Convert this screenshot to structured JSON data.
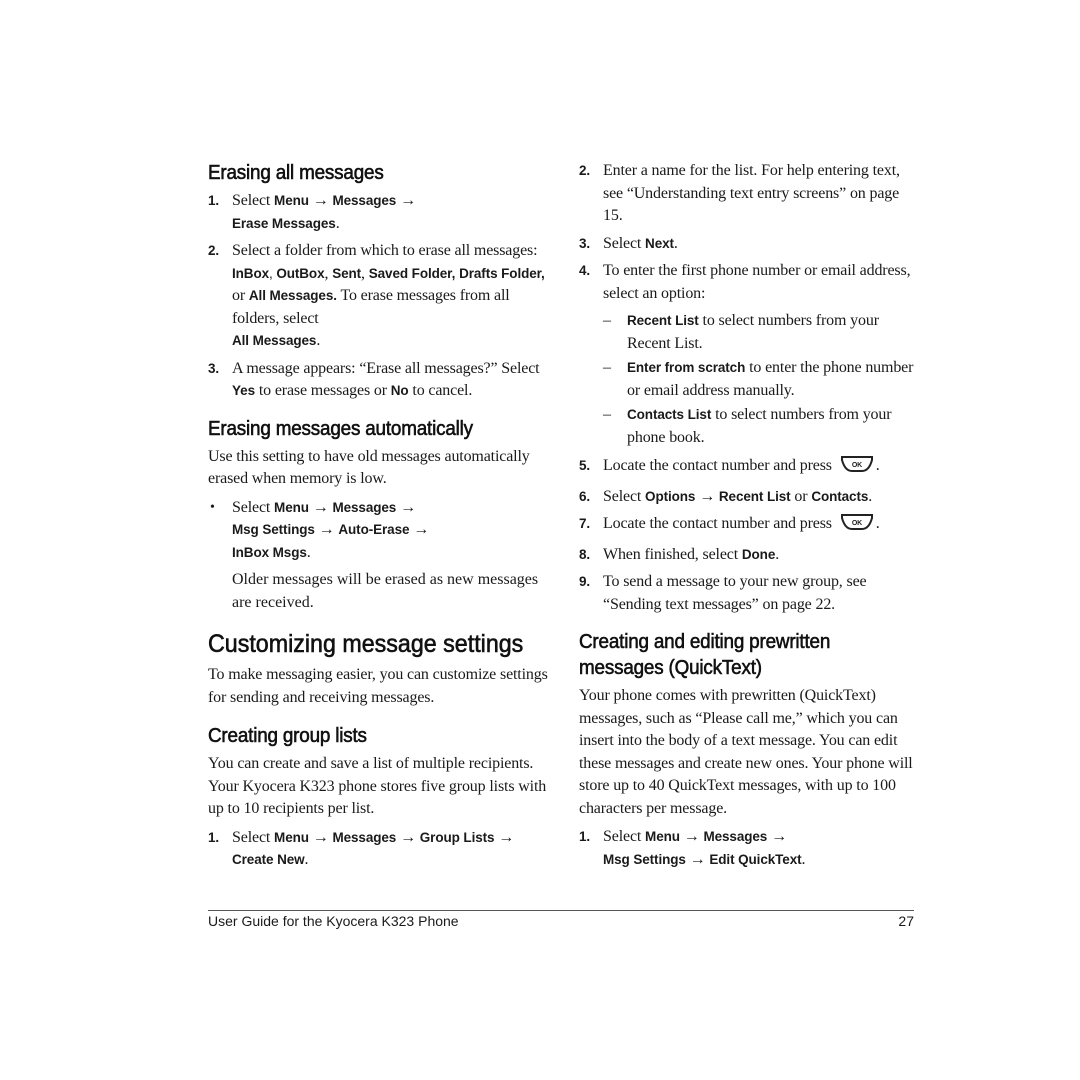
{
  "left": {
    "erasing_all": {
      "heading": "Erasing all messages",
      "step1": {
        "num": "1.",
        "t1": "Select ",
        "b1": "Menu",
        "a1": " → ",
        "b2": "Messages",
        "a2": " →",
        "b3": "Erase Messages",
        "t2": "."
      },
      "step2": {
        "num": "2.",
        "t1": "Select a folder from which to erase all messages: ",
        "b1": "InBox",
        "c1": ", ",
        "b2": "OutBox",
        "c2": ", ",
        "b3": "Sent",
        "c3": ", ",
        "b4": "Saved Folder,",
        "b5": "Drafts Folder,",
        "t2": " or ",
        "b6": "All Messages.",
        "t3": " To erase messages from all folders, select",
        "b7": "All Messages",
        "t4": "."
      },
      "step3": {
        "num": "3.",
        "t1": "A message appears: “Erase all messages?” Select ",
        "b1": "Yes",
        "t2": " to erase messages or ",
        "b2": "No",
        "t3": " to cancel."
      }
    },
    "erasing_auto": {
      "heading": "Erasing messages automatically",
      "intro": "Use this setting to have old messages automatically erased when memory is low.",
      "bullet": {
        "symbol": "•",
        "t1": "Select ",
        "b1": "Menu",
        "a1": " → ",
        "b2": "Messages",
        "a2": " →",
        "b3": "Msg Settings",
        "a3": " → ",
        "b4": "Auto-Erase",
        "a4": " →",
        "b5": "InBox Msgs",
        "t2": "."
      },
      "note": "Older messages will be erased as new messages are received."
    },
    "customizing": {
      "heading": "Customizing message settings",
      "intro": "To make messaging easier, you can customize settings for sending and receiving messages."
    },
    "group_lists": {
      "heading": "Creating group lists",
      "intro": "You can create and save a list of multiple recipients. Your Kyocera K323 phone stores five group lists with up to 10 recipients per list.",
      "step1": {
        "num": "1.",
        "t1": "Select ",
        "b1": "Menu",
        "a1": " → ",
        "b2": "Messages",
        "a2": " → ",
        "b3": "Group Lists",
        "a3": " →",
        "b4": "Create New",
        "t2": "."
      }
    }
  },
  "right": {
    "step2": {
      "num": "2.",
      "text": "Enter a name for the list. For help entering text, see “Understanding text entry screens” on page 15."
    },
    "step3": {
      "num": "3.",
      "t1": "Select ",
      "b1": "Next",
      "t2": "."
    },
    "step4": {
      "num": "4.",
      "text": "To enter the first phone number or email address, select an option:"
    },
    "options": [
      {
        "dash": "–",
        "bold": "Recent List",
        "text": " to select numbers from your Recent List."
      },
      {
        "dash": "–",
        "bold": "Enter from scratch",
        "text": " to enter the phone number or email address manually."
      },
      {
        "dash": "–",
        "bold": "Contacts List",
        "text": " to select numbers from your phone book."
      }
    ],
    "step5": {
      "num": "5.",
      "text": "Locate the contact number and press",
      "key": "OK",
      "end": "."
    },
    "step6": {
      "num": "6.",
      "t1": "Select ",
      "b1": "Options",
      "a1": " → ",
      "b2": "Recent List",
      "t2": " or ",
      "b3": "Contacts",
      "t3": "."
    },
    "step7": {
      "num": "7.",
      "text": "Locate the contact number and press",
      "key": "OK",
      "end": "."
    },
    "step8": {
      "num": "8.",
      "t1": "When finished, select ",
      "b1": "Done",
      "t2": "."
    },
    "step9": {
      "num": "9.",
      "text": "To send a message to your new group, see “Sending text messages” on page 22."
    },
    "quicktext": {
      "heading_line1": "Creating and editing prewritten",
      "heading_line2": "messages (QuickText)",
      "intro": "Your phone comes with prewritten (QuickText) messages, such as “Please call me,” which you can insert into the body of a text message. You can edit these messages and create new ones. Your phone will store up to 40 QuickText messages, with up to 100 characters per message.",
      "step1": {
        "num": "1.",
        "t1": "Select ",
        "b1": "Menu",
        "a1": " → ",
        "b2": "Messages",
        "a2": " →",
        "b3": "Msg Settings",
        "a3": " → ",
        "b4": "Edit QuickText",
        "t2": "."
      }
    }
  },
  "footer": {
    "title": "User Guide for the Kyocera K323 Phone",
    "page_number": "27"
  }
}
